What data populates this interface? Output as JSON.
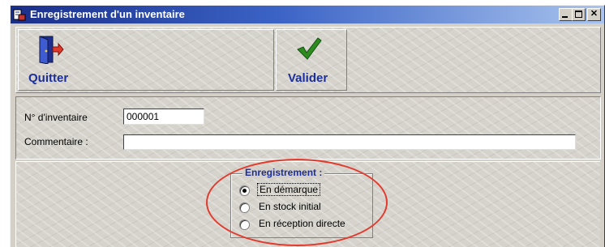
{
  "window": {
    "title": "Enregistrement d'un inventaire"
  },
  "toolbar": {
    "quit_label": "Quitter",
    "validate_label": "Valider"
  },
  "form": {
    "inventory_number_label": "N° d'inventaire",
    "inventory_number_value": "000001",
    "comment_label": "Commentaire :",
    "comment_value": ""
  },
  "registration": {
    "title": "Enregistrement :",
    "options": [
      {
        "label": "En démarque",
        "selected": true
      },
      {
        "label": "En stock initial",
        "selected": false
      },
      {
        "label": "En réception directe",
        "selected": false
      }
    ]
  },
  "colors": {
    "title_gradient_start": "#1a2f8a",
    "title_gradient_end": "#a9c4ee",
    "accent_text": "#1b2e9c",
    "highlight_ellipse": "#e23b2e",
    "validate_check": "#2e8b1f"
  },
  "icons": {
    "quit": "exit-door-icon",
    "validate": "checkmark-icon"
  }
}
